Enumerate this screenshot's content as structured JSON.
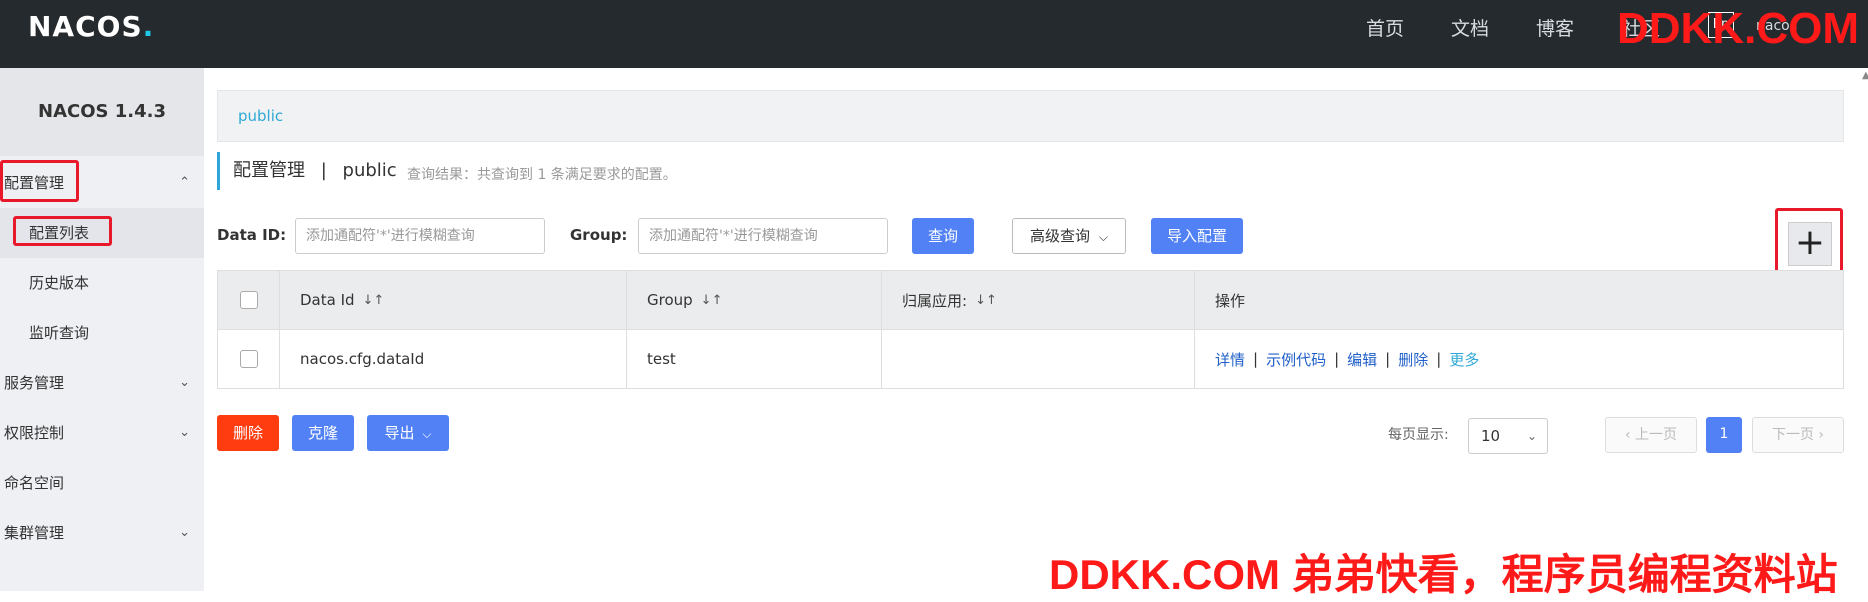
{
  "header": {
    "logo": "NACOS",
    "nav": [
      "首页",
      "文档",
      "博客",
      "社区"
    ],
    "lang_badge": "En",
    "user": "nacos",
    "watermark": "DDKK.COM"
  },
  "sidebar": {
    "version": "NACOS 1.4.3",
    "items": [
      {
        "label": "配置管理",
        "expanded": true
      },
      {
        "label": "配置列表"
      },
      {
        "label": "历史版本"
      },
      {
        "label": "监听查询"
      },
      {
        "label": "服务管理"
      },
      {
        "label": "权限控制"
      },
      {
        "label": "命名空间"
      },
      {
        "label": "集群管理"
      }
    ]
  },
  "main": {
    "namespace": "public",
    "title": "配置管理",
    "title_sep": "|",
    "title_ns": "public",
    "result_hint": "查询结果：共查询到 1 条满足要求的配置。",
    "search": {
      "data_id_label": "Data ID:",
      "data_id_placeholder": "添加通配符'*'进行模糊查询",
      "group_label": "Group:",
      "group_placeholder": "添加通配符'*'进行模糊查询",
      "query_btn": "查询",
      "advanced_btn": "高级查询",
      "import_btn": "导入配置",
      "add_btn": "+"
    },
    "table": {
      "headers": [
        "Data Id",
        "Group",
        "归属应用:",
        "操作"
      ],
      "rows": [
        {
          "data_id": "nacos.cfg.dataId",
          "group": "test",
          "app": "",
          "ops": [
            "详情",
            "示例代码",
            "编辑",
            "删除"
          ],
          "more": "更多"
        }
      ]
    },
    "bulk": {
      "delete": "删除",
      "clone": "克隆",
      "export": "导出"
    },
    "pagination": {
      "per_page_label": "每页显示:",
      "per_page": "10",
      "prev": "上一页",
      "current": "1",
      "next": "下一页"
    },
    "watermark": "DDKK.COM 弟弟快看，程序员编程资料站"
  },
  "colors": {
    "header_bg": "#252a2f",
    "primary": "#5181f5",
    "danger": "#ff3b10",
    "accent": "#2fa9d6",
    "highlight": "#e8192a"
  }
}
